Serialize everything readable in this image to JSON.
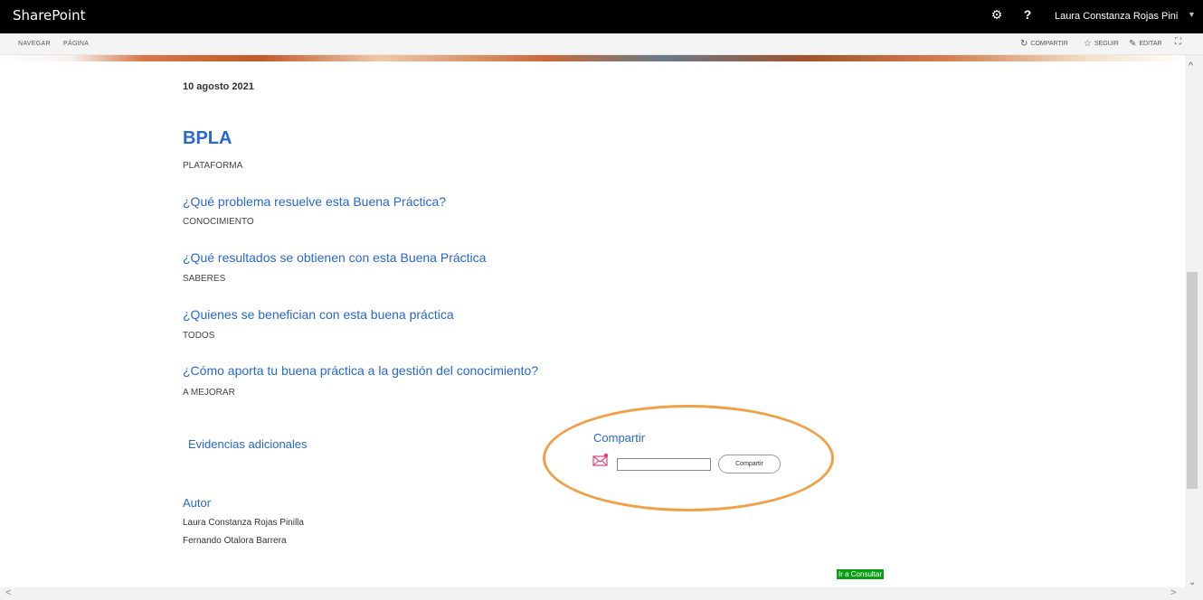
{
  "suite": {
    "brand": "SharePoint",
    "gear_icon": "⚙",
    "help_icon": "?",
    "user_name": "Laura Constanza Rojas Pini",
    "user_caret": "▼"
  },
  "ribbon": {
    "tabs": [
      "NAVEGAR",
      "PÁGINA"
    ],
    "actions": {
      "share": "COMPARTIR",
      "follow": "SEGUIR",
      "edit": "EDITAR"
    },
    "icons": {
      "share": "↻",
      "follow": "☆",
      "edit": "✎",
      "focus": "⛶"
    }
  },
  "page": {
    "date": "10 agosto 2021",
    "title": "BPLA",
    "subtitle": "PLATAFORMA",
    "sections": [
      {
        "question": "¿Qué problema resuelve esta Buena Práctica?",
        "answer": "CONOCIMIENTO"
      },
      {
        "question": "¿Qué resultados se obtienen con esta Buena Práctica",
        "answer": "SABERES"
      },
      {
        "question": "¿Quienes se benefician con esta buena práctica",
        "answer": "TODOS"
      },
      {
        "question": "¿Cómo aporta tu buena práctica a la gestión del conocimiento?",
        "answer": "A MEJORAR"
      }
    ],
    "evidence_link": "Evidencias adicionales",
    "share": {
      "title": "Compartir",
      "input_value": "",
      "button_label": "Compartir",
      "highlight_color": "#f0a047"
    },
    "author": {
      "label": "Autor",
      "names": [
        "Laura Constanza Rojas Pinilla",
        "Fernando Otalora Barrera"
      ]
    },
    "consult_button": "Ir a Consultar"
  },
  "scrollbars": {
    "up": "^",
    "down": "⌄",
    "left": "<",
    "right": ">"
  },
  "colors": {
    "link_blue": "#2767d6",
    "suite_bg": "#000000",
    "consult_green": "#0a9e14"
  }
}
